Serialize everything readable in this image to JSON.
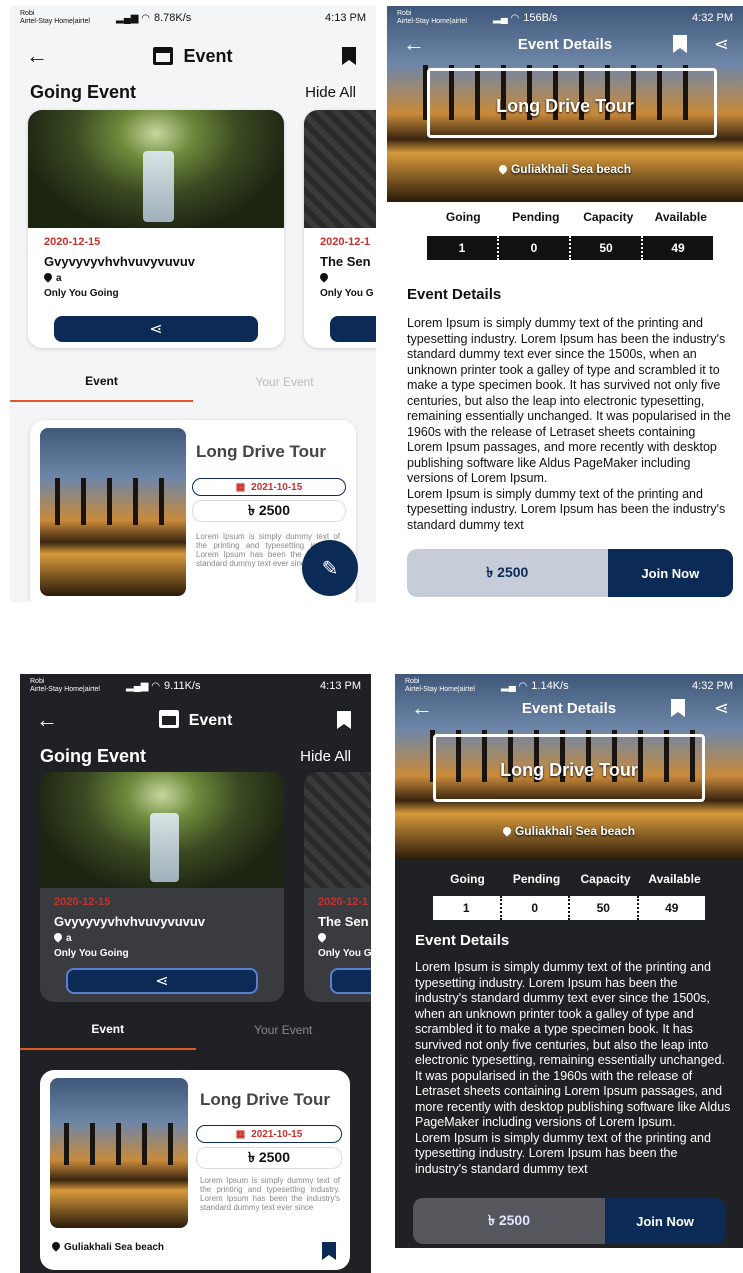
{
  "status_tl": {
    "carrier": "Robi\nAirtel-Stay Home|airtel",
    "speed": "8.78K/s",
    "right": "4:13 PM"
  },
  "status_tr": {
    "carrier": "Robi\nAirtel-Stay Home|airtel",
    "speed": "156B/s",
    "right": "4:32 PM"
  },
  "status_bl": {
    "carrier": "Robi\nAirtel-Stay Home|airtel",
    "speed": "9.11K/s",
    "right": "4:13 PM"
  },
  "status_br": {
    "carrier": "Robi\nAirtel-Stay Home|airtel",
    "speed": "1.14K/s",
    "right": "4:32 PM"
  },
  "event_screen": {
    "title": "Event",
    "going_heading": "Going Event",
    "hide_all": "Hide All",
    "card1": {
      "date": "2020-12-15",
      "name": "Gvyvyvyvhvhvuvyvuvuv",
      "location": "a",
      "status": "Only You Going"
    },
    "card2": {
      "date": "2020-12-1",
      "name": "The Sen",
      "location": "",
      "status": "Only You G"
    },
    "tabs": [
      "Event",
      "Your Event"
    ],
    "list_item": {
      "title": "Long Drive Tour",
      "date": "2021-10-15",
      "price": "৳ 2500",
      "desc": "Lorem Ipsum is simply dummy text of the printing and typesetting industry. Lorem Ipsum has been the industry's standard dummy text ever since",
      "location": "Guliakhali Sea beach"
    }
  },
  "details_screen": {
    "title": "Event Details",
    "hero_title": "Long Drive Tour",
    "hero_location": "Guliakhali Sea beach",
    "stats": {
      "labels": [
        "Going",
        "Pending",
        "Capacity",
        "Available"
      ],
      "values": [
        "1",
        "0",
        "50",
        "49"
      ]
    },
    "section_heading": "Event Details",
    "body": "Lorem Ipsum is simply dummy text of the printing and typesetting industry. Lorem Ipsum has been the industry's standard dummy text ever since the 1500s, when an unknown printer took a galley of type and scrambled it to make a type specimen book. It has survived not only five centuries, but also the leap into electronic typesetting, remaining essentially unchanged. It was popularised in the 1960s with the release of Letraset sheets containing Lorem Ipsum passages, and more recently with desktop publishing software like Aldus PageMaker including versions of Lorem Ipsum.\nLorem Ipsum is simply dummy text of the printing and typesetting industry. Lorem Ipsum has been the industry's standard dummy text",
    "price": "৳ 2500",
    "join": "Join Now"
  },
  "colors": {
    "navy": "#0c2a56",
    "accent_red": "#c9302c",
    "tab_underline": "#e0572b",
    "dark_bg": "#202124"
  }
}
